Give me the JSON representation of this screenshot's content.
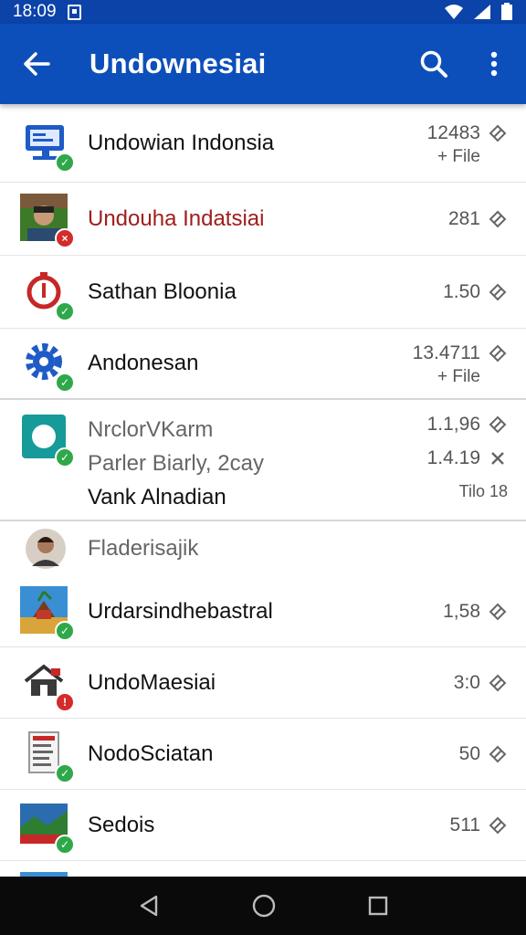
{
  "status_bar": {
    "time": "18:09"
  },
  "app_bar": {
    "title": "Undownesiai"
  },
  "items": [
    {
      "title": "Undowian Indonsia",
      "value": "12483",
      "sub": "+ File",
      "thumb": "monitor-icon",
      "status": "ok"
    },
    {
      "title": "Undouha Indatsiai",
      "value": "281",
      "sub": "",
      "thumb": "person-photo",
      "status": "err"
    },
    {
      "title": "Sathan Bloonia",
      "value": "1.50",
      "sub": "",
      "thumb": "timer-icon",
      "status": "ok"
    },
    {
      "title": "Andonesan",
      "value": "13.4711",
      "sub": "+ File",
      "thumb": "gear-icon",
      "status": "ok"
    }
  ],
  "group": {
    "lines": [
      "NrclorVKarm",
      "Parler Biarly, 2cay",
      "Vank Alnadian"
    ],
    "values": [
      "1.1,96",
      "1.4.19"
    ],
    "footer": "Tilo 18"
  },
  "items2": [
    {
      "title": "Fladerisajik",
      "value": "",
      "thumb": "person-avatar",
      "status": "none"
    },
    {
      "title": "Urdarsindhebastral",
      "value": "1,58",
      "thumb": "beach-photo",
      "status": "ok"
    },
    {
      "title": "UndoMaesiai",
      "value": "3:0",
      "thumb": "house-icon",
      "status": "err"
    },
    {
      "title": "NodoSciatan",
      "value": "50",
      "thumb": "document-icon",
      "status": "ok"
    },
    {
      "title": "Sedois",
      "value": "511",
      "thumb": "landscape-photo",
      "status": "ok"
    }
  ],
  "colors": {
    "app_bar": "#0d4fba",
    "status_ok": "#2fa84a",
    "status_err": "#d42b2b"
  }
}
